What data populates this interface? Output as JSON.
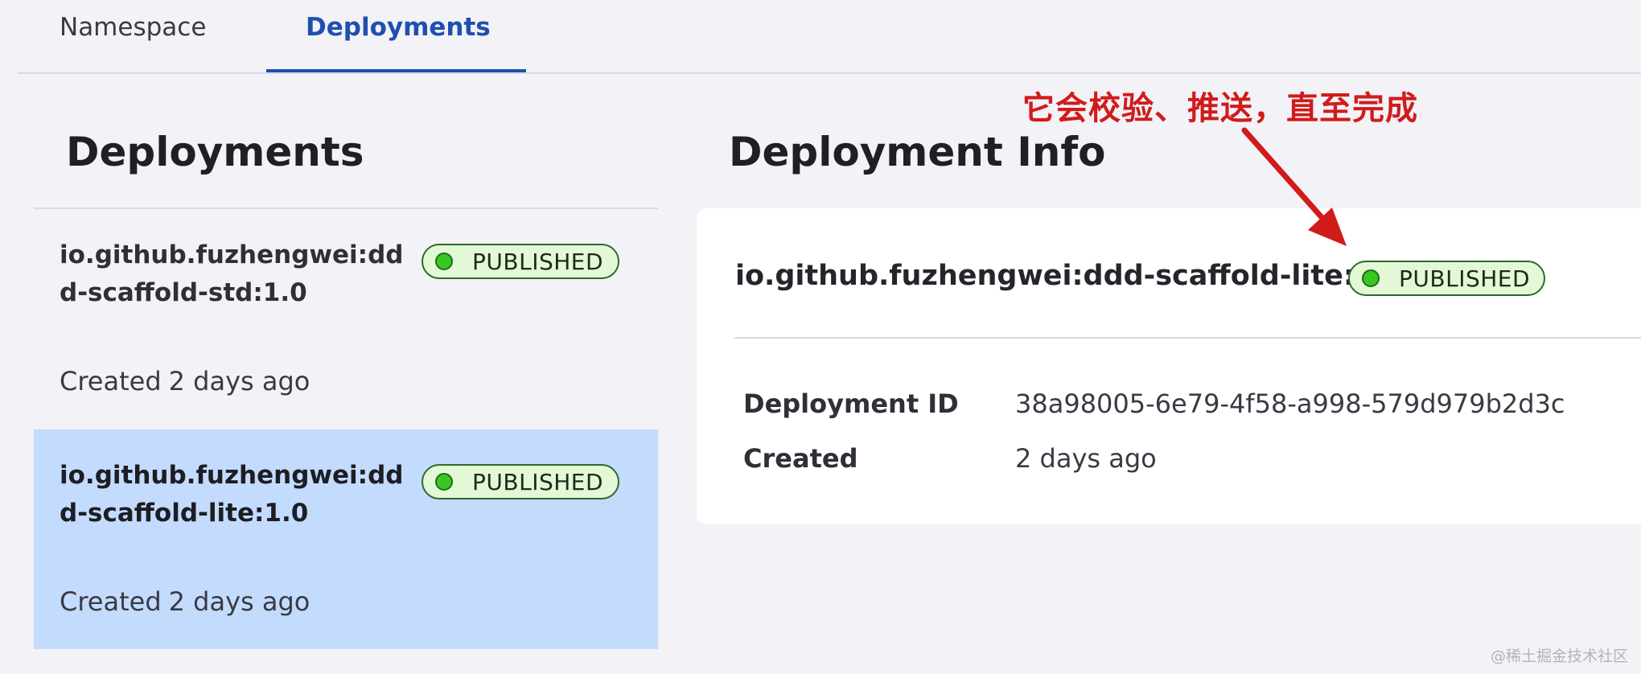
{
  "tabs": [
    {
      "label": "Namespace",
      "active": false
    },
    {
      "label": "Deployments",
      "active": true
    }
  ],
  "left_panel": {
    "title": "Deployments",
    "items": [
      {
        "name": "io.github.fuzhengwei:ddd-scaffold-std:1.0",
        "status": "PUBLISHED",
        "created_prefix": "Created",
        "created_ago": "2 days ago",
        "selected": false
      },
      {
        "name": "io.github.fuzhengwei:ddd-scaffold-lite:1.0",
        "status": "PUBLISHED",
        "created_prefix": "Created",
        "created_ago": "2 days ago",
        "selected": true
      }
    ]
  },
  "right_panel": {
    "title": "Deployment Info",
    "name": "io.github.fuzhengwei:ddd-scaffold-lite:1.0",
    "status": "PUBLISHED",
    "fields": [
      {
        "label": "Deployment ID",
        "value": "38a98005-6e79-4f58-a998-579d979b2d3c"
      },
      {
        "label": "Created",
        "value": "2 days ago"
      }
    ]
  },
  "annotation": {
    "text": "它会校验、推送，直至完成"
  },
  "watermark": "@稀土掘金技术社区",
  "colors": {
    "accent": "#1f4fb0",
    "selected_bg": "#c3dbfc",
    "badge_bg": "#e3f9d6",
    "badge_dot": "#3bc723",
    "annotation": "#d11b1b"
  },
  "icons": {
    "status_dot": "status-dot-icon",
    "annotation_arrow": "arrow-icon"
  }
}
